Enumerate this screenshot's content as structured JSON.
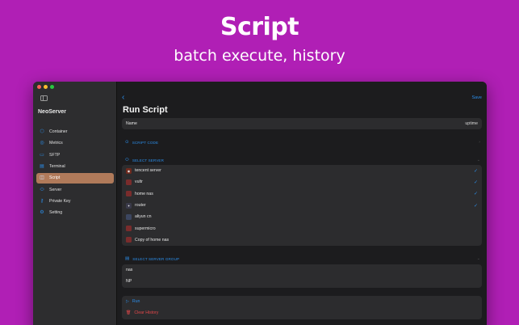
{
  "hero": {
    "title": "Script",
    "subtitle": "batch execute, history"
  },
  "colors": {
    "background": "#b01fb5",
    "accent": "#2b8de8",
    "danger": "#e4484a",
    "active_nav": "#b07a5a"
  },
  "sidebar": {
    "app_name": "NeoServer",
    "toggle_icon": "sidebar-toggle-icon",
    "items": [
      {
        "label": "Container",
        "icon": "container-icon",
        "glyph": "⬡"
      },
      {
        "label": "Metrics",
        "icon": "metrics-icon",
        "glyph": "◎"
      },
      {
        "label": "SFTP",
        "icon": "folder-icon",
        "glyph": "▭"
      },
      {
        "label": "Terminal",
        "icon": "terminal-icon",
        "glyph": "▤"
      },
      {
        "label": "Script",
        "icon": "script-icon",
        "glyph": "◫",
        "active": true
      },
      {
        "label": "Server",
        "icon": "server-icon",
        "glyph": "⬭"
      },
      {
        "label": "Private Key",
        "icon": "key-icon",
        "glyph": "⚷"
      },
      {
        "label": "Setting",
        "icon": "gear-icon",
        "glyph": "⚙"
      }
    ]
  },
  "toolbar": {
    "back_icon": "chevron-left-icon",
    "save_label": "Save"
  },
  "page": {
    "title": "Run Script"
  },
  "name_field": {
    "label": "Name",
    "value": "uptime"
  },
  "script_code": {
    "header": "SCRIPT CODE",
    "icon": "code-icon"
  },
  "select_server": {
    "header": "SELECT SERVER",
    "icon": "server-icon",
    "servers": [
      {
        "name": "tencent server",
        "checked": true,
        "icon": "tencent-icon"
      },
      {
        "name": "vultr",
        "checked": true,
        "icon": "vultr-icon"
      },
      {
        "name": "home nas",
        "checked": true,
        "icon": "nas-icon"
      },
      {
        "name": "router",
        "checked": true,
        "icon": "router-icon"
      },
      {
        "name": "aliyun cn",
        "checked": false,
        "icon": "aliyun-icon"
      },
      {
        "name": "supermicro",
        "checked": false,
        "icon": "supermicro-icon"
      },
      {
        "name": "Copy of home nas",
        "checked": false,
        "icon": "nas-icon"
      }
    ]
  },
  "select_group": {
    "header": "SELECT SERVER GROUP",
    "icon": "group-icon",
    "groups": [
      {
        "name": "nas"
      },
      {
        "name": "NP"
      }
    ]
  },
  "actions": {
    "run_label": "Run",
    "clear_label": "Clear History"
  }
}
